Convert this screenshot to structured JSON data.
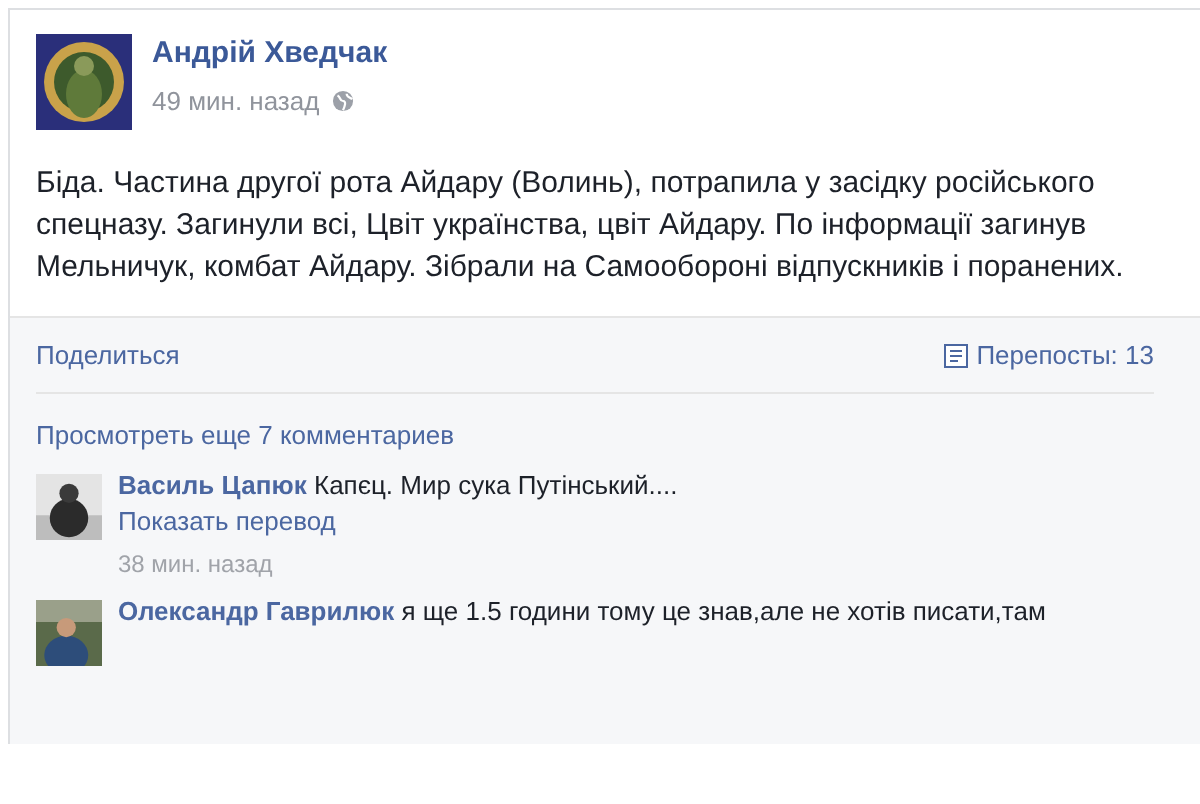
{
  "post": {
    "author": "Андрій Хведчак",
    "time": "49 мин. назад",
    "text": "Біда. Частина другої рота Айдару (Волинь), потрапила у засідку російського спецназу. Загинули всі, Цвіт українства, цвіт Айдару. По інформації загинув Мельничук, комбат Айдару. Зібрали на Самообороні відпускників і поранених."
  },
  "actions": {
    "share": "Поделиться",
    "reposts": "Перепосты: 13"
  },
  "more_comments": "Просмотреть еще 7 комментариев",
  "comments": [
    {
      "author": "Василь Цапюк",
      "text": "Капєц. Мир сука Путінський....",
      "translate": "Показать перевод",
      "time": "38 мин. назад"
    },
    {
      "author": "Олександр Гаврилюк",
      "text": "я ще 1.5 години тому це знав,але не хотів писати,там"
    }
  ]
}
